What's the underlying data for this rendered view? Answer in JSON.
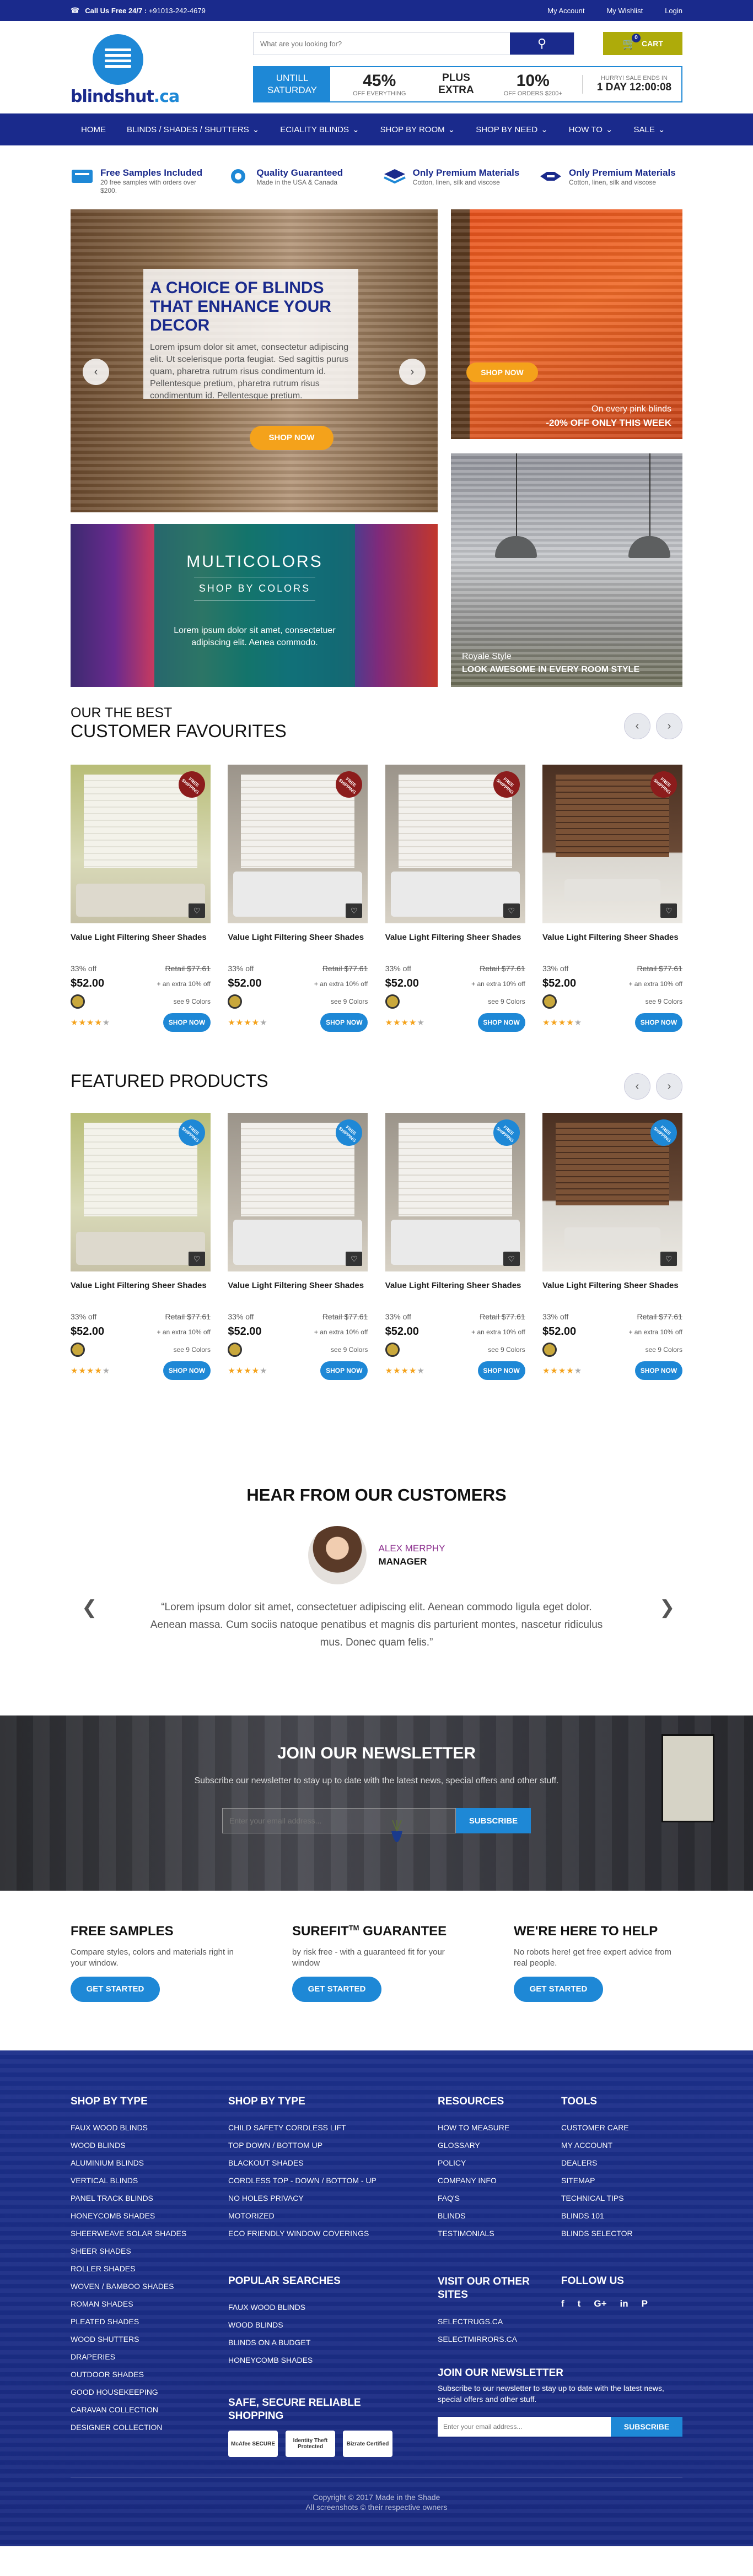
{
  "topbar": {
    "phone_label": "Call Us Free 24/7 :",
    "phone": "+91013-242-4679",
    "links": [
      "My Account",
      "My Wishlist",
      "Login"
    ]
  },
  "header": {
    "logo_text": "blindshut",
    "logo_tld": ".ca",
    "search_placeholder": "What are you looking for?",
    "cart_label": "CART",
    "cart_count": "0"
  },
  "promo": {
    "until_line1": "UNTILL",
    "until_line2": "SATURDAY",
    "offer1_big": "45%",
    "offer1_small": "OFF EVERYTHING",
    "plus_line1": "PLUS",
    "plus_line2": "EXTRA",
    "offer2_big": "10%",
    "offer2_small": "OFF ORDERS $200+",
    "hurry": "HURRY! SALE ENDS IN",
    "countdown": "1 DAY 12:00:08"
  },
  "nav": [
    "HOME",
    "BLINDS / SHADES / SHUTTERS",
    "ECIALITY BLINDS",
    "SHOP BY ROOM",
    "SHOP BY NEED",
    "HOW TO",
    "SALE"
  ],
  "benefits": [
    {
      "title": "Free Samples Included",
      "sub": "20 free samples with orders over $200."
    },
    {
      "title": "Quality Guaranteed",
      "sub": "Made in the USA & Canada"
    },
    {
      "title": "Only Premium Materials",
      "sub": "Cotton, linen, silk and viscose"
    },
    {
      "title": "Only Premium Materials",
      "sub": "Cotton, linen, silk and viscose"
    }
  ],
  "hero": {
    "title": "A CHOICE OF BLINDS THAT ENHANCE YOUR DECOR",
    "body": "Lorem ipsum dolor sit amet, consectetur adipiscing elit. Ut scelerisque porta feugiat. Sed sagittis purus quam, pharetra rutrum risus condimentum id. Pellentesque pretium, pharetra rutrum risus condimentum id. Pellentesque pretium.",
    "cta": "SHOP NOW",
    "orange_cta": "SHOP NOW",
    "orange_cap1": "On every pink blinds",
    "orange_cap2": "-20% OFF ONLY THIS WEEK",
    "multi_h1": "MULTICOLORS",
    "multi_h2": "SHOP BY COLORS",
    "multi_body": "Lorem ipsum dolor sit amet, consectetuer adipiscing elit. Aenea commodo.",
    "royale_a": "Royale Style",
    "royale_b": "LOOK AWESOME IN EVERY ROOM STYLE"
  },
  "favourites": {
    "kicker": "OUR THE BEST",
    "title": "CUSTOMER FAVOURITES"
  },
  "featured": {
    "title": "FEATURED PRODUCTS"
  },
  "product_card": {
    "name": "Value Light Filtering Sheer Shades",
    "discount": "33% off",
    "retail": "Retail $77.61",
    "price": "$52.00",
    "extra": "+ an extra 10% off",
    "colors": "see 9 Colors",
    "shop": "SHOP NOW",
    "rating": 4,
    "ribbon": "FREE SHIPPING"
  },
  "colors": {
    "navy": "#1a2a8c",
    "blue": "#1e88d6",
    "orange": "#f4a21b",
    "olive": "#aeab0a",
    "ribbon_red": "#8c1c1c"
  },
  "testimonial": {
    "heading": "HEAR FROM OUR CUSTOMERS",
    "name": "ALEX MERPHY",
    "role": "MANAGER",
    "quote": "“Lorem ipsum dolor sit amet, consectetuer adipiscing elit. Aenean commodo ligula eget dolor. Aenean massa. Cum sociis natoque penatibus et magnis dis parturient montes, nascetur ridiculus mus. Donec quam felis.”"
  },
  "newsletter": {
    "heading": "JOIN OUR NEWSLETTER",
    "sub": "Subscribe our newsletter to stay up to date with the latest news, special offers and other stuff.",
    "placeholder": "Enter your email address...",
    "button": "SUBSCRIBE"
  },
  "help": [
    {
      "title": "FREE SAMPLES",
      "body": "Compare styles, colors and materials right in your window.",
      "cta": "GET STARTED"
    },
    {
      "title": "SUREFIT",
      "sup": "TM",
      "title2": " GUARANTEE",
      "body": "by risk free - with a guaranteed fit for your window",
      "cta": "GET STARTED"
    },
    {
      "title": "WE'RE HERE TO HELP",
      "body": "No robots here! get free expert advice from real people.",
      "cta": "GET STARTED"
    }
  ],
  "footer": {
    "col1": {
      "title": "SHOP BY TYPE",
      "items": [
        "FAUX WOOD BLINDS",
        "WOOD BLINDS",
        "ALUMINIUM BLINDS",
        "VERTICAL BLINDS",
        "PANEL TRACK BLINDS",
        "HONEYCOMB SHADES",
        "SHEERWEAVE SOLAR SHADES",
        "SHEER SHADES",
        "ROLLER SHADES",
        "WOVEN / BAMBOO SHADES",
        "ROMAN SHADES",
        "PLEATED SHADES",
        "WOOD SHUTTERS",
        "DRAPERIES",
        "OUTDOOR SHADES",
        "GOOD HOUSEKEEPING",
        "CARAVAN COLLECTION",
        "DESIGNER COLLECTION"
      ]
    },
    "col2": {
      "title": "SHOP BY TYPE",
      "items": [
        "CHILD SAFETY CORDLESS LIFT",
        "TOP DOWN / BOTTOM UP",
        "BLACKOUT SHADES",
        "CORDLESS TOP - DOWN / BOTTOM - UP",
        "NO HOLES PRIVACY",
        "MOTORIZED",
        "ECO FRIENDLY WINDOW COVERINGS"
      ]
    },
    "col2b": {
      "title": "POPULAR SEARCHES",
      "items": [
        "FAUX WOOD BLINDS",
        "WOOD BLINDS",
        "BLINDS ON A BUDGET",
        "HONEYCOMB SHADES"
      ]
    },
    "col2c": {
      "title": "SAFE, SECURE RELIABLE SHOPPING",
      "badges": [
        "McAfee SECURE",
        "Identity Theft Protected",
        "Bizrate Certified"
      ]
    },
    "col3": {
      "title": "RESOURCES",
      "items": [
        "HOW TO MEASURE",
        "GLOSSARY",
        "POLICY",
        "COMPANY INFO",
        "FAQ'S",
        "BLINDS",
        "TESTIMONIALS"
      ]
    },
    "col3b": {
      "title": "VISIT OUR OTHER SITES",
      "items": [
        "SELECTRUGS.CA",
        "SELECTMIRRORS.CA"
      ]
    },
    "col4": {
      "title": "TOOLS",
      "items": [
        "CUSTOMER CARE",
        "MY ACCOUNT",
        "DEALERS",
        "SITEMAP",
        "TECHNICAL TIPS",
        "BLINDS 101",
        "BLINDS SELECTOR"
      ]
    },
    "col4b": {
      "title": "FOLLOW US",
      "icons": [
        "f",
        "t",
        "G+",
        "in",
        "P"
      ]
    },
    "news": {
      "title": "JOIN OUR NEWSLETTER",
      "body": "Subscribe to our newsletter to stay up to date with the latest news, special offers and other stuff.",
      "placeholder": "Enter your email address...",
      "button": "SUBSCRIBE"
    },
    "copyright1": "Copyright © 2017 Made in the Shade",
    "copyright2": "All screenshots © their respective owners"
  }
}
